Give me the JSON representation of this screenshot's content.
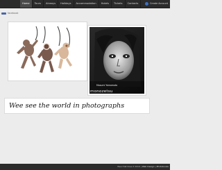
{
  "nav": {
    "items": [
      "Home",
      "Tours",
      "Airways",
      "Holidays",
      "Accommodation",
      "Hotels",
      "Tickets",
      "Contacts"
    ],
    "active_index": 0
  },
  "login": {
    "label": "Create Account"
  },
  "breadcrumb": {
    "label": "facebook"
  },
  "gallery": {
    "left_photo": {
      "alt": "hanging-monkeys-photo"
    },
    "right_photo": {
      "alt": "portrait-photo",
      "caption_small": "Masumi Yamamoto",
      "caption_large": "monozetsu"
    }
  },
  "caption": {
    "text": "Wee see the world in photographs"
  },
  "footer": {
    "text": "Wee that likes it 2019",
    "credit": "Web Design",
    "brand": "Photobooks"
  }
}
